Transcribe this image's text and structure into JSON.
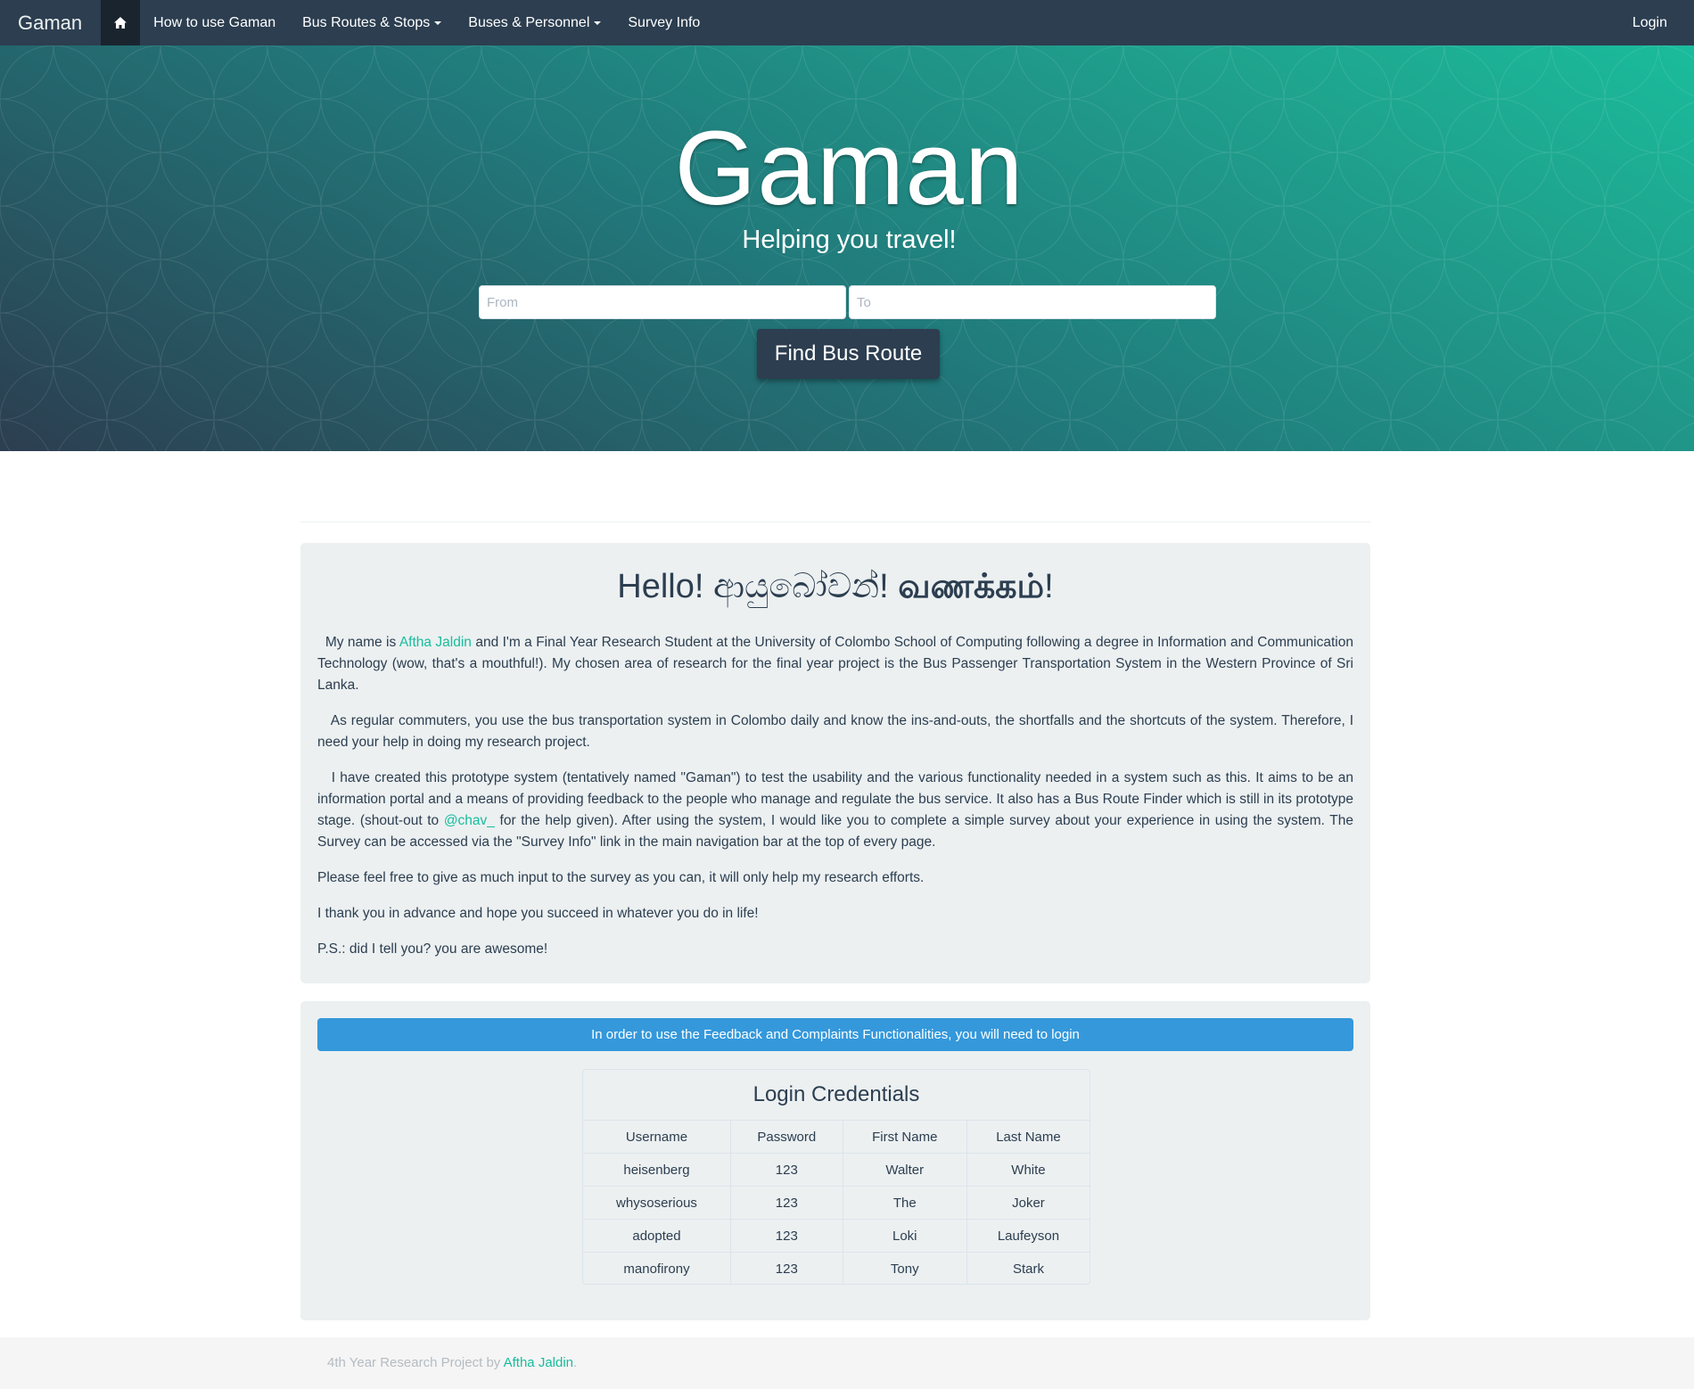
{
  "colors": {
    "nav_bg": "#2c3e50",
    "accent": "#18bc9c",
    "info": "#3498db",
    "well_bg": "#ecf0f1"
  },
  "navbar": {
    "brand": "Gaman",
    "home_icon": "home-icon",
    "links": [
      "How to use Gaman",
      "Bus Routes & Stops",
      "Buses & Personnel",
      "Survey Info"
    ],
    "login": "Login"
  },
  "hero": {
    "title": "Gaman",
    "subtitle": "Helping you travel!",
    "from_placeholder": "From",
    "to_placeholder": "To",
    "button": "Find Bus Route"
  },
  "intro": {
    "greeting_latin": "Hello!",
    "greeting_sinhala": "ආයුබෝවන්!",
    "greeting_tamil": "வணக்கம்",
    "greeting_end": "!",
    "p1_a": "My name is ",
    "p1_link": "Aftha Jaldin",
    "p1_b": " and I'm a Final Year Research Student at the University of Colombo School of Computing following a degree in Information and Communication Technology (wow, that's a mouthful!). My chosen area of research for the final year project is the Bus Passenger Transportation System in the Western Province of Sri Lanka.",
    "p2": "As regular commuters, you use the bus transportation system in Colombo daily and know the ins-and-outs, the shortfalls and the shortcuts of the system. Therefore, I need your help in doing my research project.",
    "p3_a": "I have created this prototype system (tentatively named \"Gaman\") to test the usability and the various functionality needed in a system such as this. It aims to be an information portal and a means of providing feedback to the people who manage and regulate the bus service. It also has a Bus Route Finder which is still in its prototype stage. (shout-out to ",
    "p3_link": "@chav_",
    "p3_b": " for the help given). After using the system, I would like you to complete a simple survey about your experience in using the system. The Survey can be accessed via the \"Survey Info\" link in the main navigation bar at the top of every page.",
    "p4": "Please feel free to give as much input to the survey as you can, it will only help my research efforts.",
    "p5": "I thank you in advance and hope you succeed in whatever you do in life!",
    "p6": "P.S.: did I tell you? you are awesome!"
  },
  "login_notice": "In order to use the Feedback and Complaints Functionalities, you will need to login",
  "credentials": {
    "title": "Login Credentials",
    "headers": [
      "Username",
      "Password",
      "First Name",
      "Last Name"
    ],
    "rows": [
      [
        "heisenberg",
        "123",
        "Walter",
        "White"
      ],
      [
        "whysoserious",
        "123",
        "The",
        "Joker"
      ],
      [
        "adopted",
        "123",
        "Loki",
        "Laufeyson"
      ],
      [
        "manofirony",
        "123",
        "Tony",
        "Stark"
      ]
    ]
  },
  "footer": {
    "text_a": "4th Year Research Project by ",
    "link": "Aftha Jaldin",
    "text_b": "."
  }
}
